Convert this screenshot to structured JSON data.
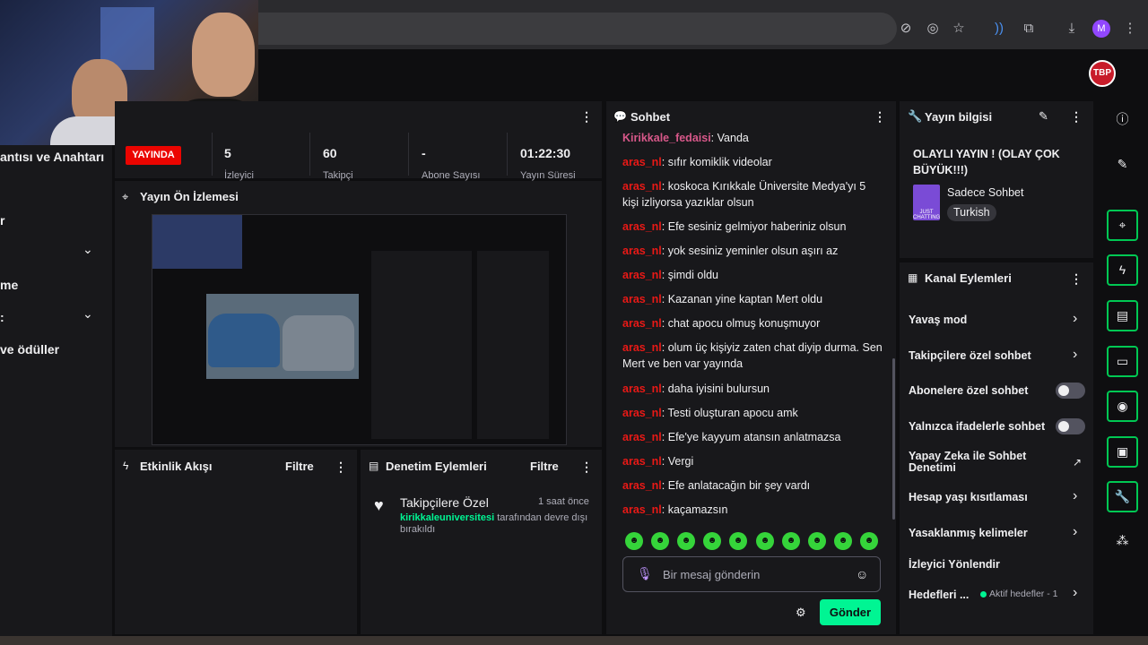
{
  "browser": {
    "icons": [
      "tracking-off-icon",
      "eye-off-icon",
      "star-icon",
      "cast-icon",
      "extensions-icon",
      "download-icon"
    ],
    "profile_initial": "M"
  },
  "channel_logo_text": "TBP",
  "left_nav": {
    "items": [
      {
        "label": "antısı ve Anahtarı"
      },
      {
        "label": "r"
      },
      {
        "label": "me"
      },
      {
        "label": ":"
      },
      {
        "label": "ve ödüller"
      }
    ]
  },
  "stats": {
    "live_label": "YAYINDA",
    "items": [
      {
        "value": "5",
        "label": "İzleyici"
      },
      {
        "value": "60",
        "label": "Takipçi"
      },
      {
        "value": "-",
        "label": "Abone Sayısı"
      },
      {
        "value": "01:22:30",
        "label": "Yayın Süresi"
      }
    ]
  },
  "preview": {
    "title": "Yayın Ön İzlemesi"
  },
  "activity_feed": {
    "title": "Etkinlik Akışı",
    "filter": "Filtre"
  },
  "mod_actions": {
    "title": "Denetim Eylemleri",
    "filter": "Filtre",
    "entry": {
      "title": "Takipçilere Özel",
      "time": "1 saat önce",
      "user": "kirikkaleuniversitesi",
      "text": "tarafından devre dışı bırakıldı"
    }
  },
  "chat": {
    "title": "Sohbet",
    "messages": [
      {
        "user": "Kirikkale_fedaisi",
        "text": "Vanda",
        "pink": true
      },
      {
        "user": "aras_nl",
        "text": "sıfır komiklik videolar"
      },
      {
        "user": "aras_nl",
        "text": "koskoca Kırıkkale Üniversite Medya'yı 5 kişi izliyorsa yazıklar olsun"
      },
      {
        "user": "aras_nl",
        "text": "Efe sesiniz gelmiyor haberiniz olsun"
      },
      {
        "user": "aras_nl",
        "text": "yok sesiniz yeminler olsun aşırı az"
      },
      {
        "user": "aras_nl",
        "text": "şimdi oldu"
      },
      {
        "user": "aras_nl",
        "text": "Kazanan yine kaptan Mert oldu"
      },
      {
        "user": "aras_nl",
        "text": "chat apocu olmuş konuşmuyor"
      },
      {
        "user": "aras_nl",
        "text": "olum üç kişiyiz zaten chat diyip durma. Sen Mert ve ben var yayında"
      },
      {
        "user": "aras_nl",
        "text": "daha iyisini bulursun"
      },
      {
        "user": "aras_nl",
        "text": "Testi oluşturan apocu amk"
      },
      {
        "user": "aras_nl",
        "text": "Efe'ye kayyum atansın anlatmazsa"
      },
      {
        "user": "aras_nl",
        "text": "Vergi"
      },
      {
        "user": "aras_nl",
        "text": "Efe anlatacağın bir şey vardı"
      },
      {
        "user": "aras_nl",
        "text": "kaçamazsın"
      }
    ],
    "input_placeholder": "Bir mesaj gönderin",
    "send_label": "Gönder"
  },
  "stream_info": {
    "title": "Yayın bilgisi",
    "stream_title": "OLAYLI YAYIN ! (OLAY ÇOK BÜYÜK!!!)",
    "category": "Sadece Sohbet",
    "category_box_text": "JUST CHATTING",
    "tag": "Turkish"
  },
  "channel_actions": {
    "title": "Kanal Eylemleri",
    "items": [
      {
        "label": "Yavaş mod",
        "control": "chevron"
      },
      {
        "label": "Takipçilere özel sohbet",
        "control": "chevron"
      },
      {
        "label": "Abonelere özel sohbet",
        "control": "toggle"
      },
      {
        "label": "Yalnızca ifadelerle sohbet",
        "control": "toggle"
      },
      {
        "label": "Yapay Zeka ile Sohbet Denetimi",
        "control": "external"
      },
      {
        "label": "Hesap yaşı kısıtlaması",
        "control": "chevron"
      },
      {
        "label": "Yasaklanmış kelimeler",
        "control": "chevron"
      },
      {
        "label": "İzleyici Yönlendir",
        "control": "none"
      },
      {
        "label": "Hedefleri ...",
        "control": "chevron",
        "extra": "Aktif hedefler - 1"
      }
    ]
  },
  "right_rail": {
    "icons": [
      "info-icon",
      "pencil-icon",
      "screenshot-icon",
      "lightning-icon",
      "notes-icon",
      "chat-bubble-icon",
      "broadcast-icon",
      "camera-icon",
      "wrench-icon",
      "share-icon"
    ]
  }
}
